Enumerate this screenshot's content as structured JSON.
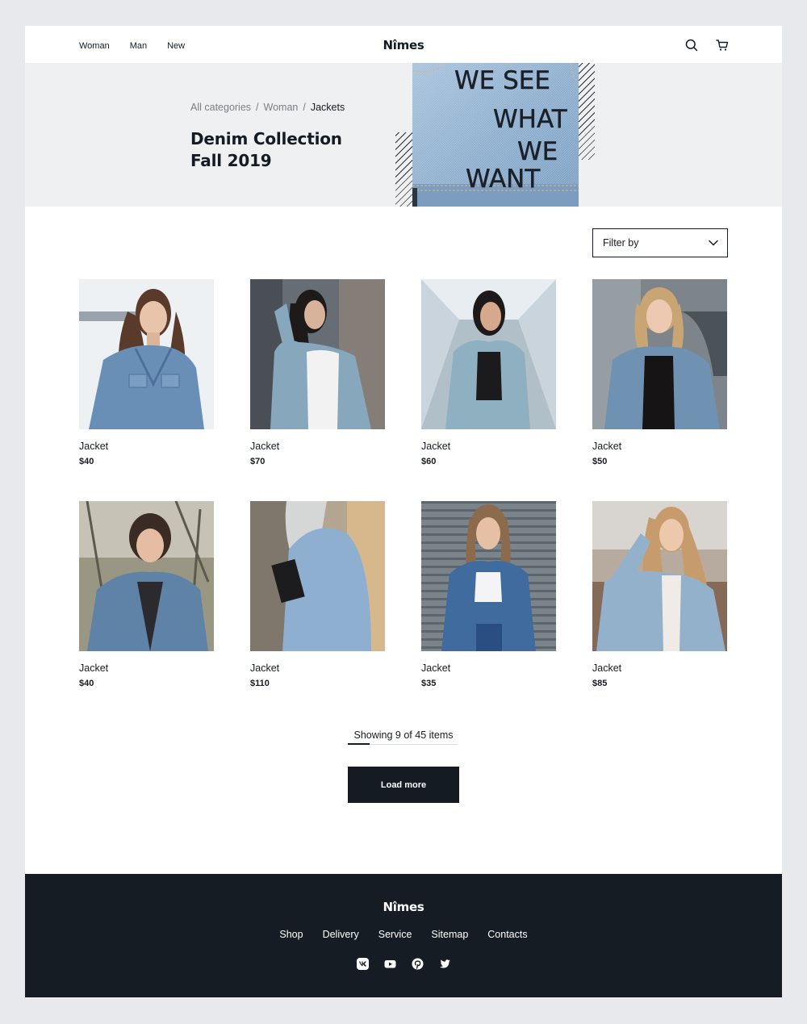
{
  "header": {
    "nav": [
      "Woman",
      "Man",
      "New"
    ],
    "logo": "Nîmes",
    "icons": [
      "search-icon",
      "cart-icon"
    ]
  },
  "hero": {
    "breadcrumb": [
      "All categories",
      "Woman",
      "Jackets"
    ],
    "title_line1": "Denim Collection",
    "title_line2": "Fall 2019",
    "image_text": [
      "WE SEE",
      "WHAT",
      "WE",
      "WANT"
    ]
  },
  "filter": {
    "label": "Filter by"
  },
  "products": [
    {
      "name": "Jacket",
      "price": "$40"
    },
    {
      "name": "Jacket",
      "price": "$70"
    },
    {
      "name": "Jacket",
      "price": "$60"
    },
    {
      "name": "Jacket",
      "price": "$50"
    },
    {
      "name": "Jacket",
      "price": "$40"
    },
    {
      "name": "Jacket",
      "price": "$110"
    },
    {
      "name": "Jacket",
      "price": "$35"
    },
    {
      "name": "Jacket",
      "price": "$85"
    }
  ],
  "pagination": {
    "showing": "Showing 9 of 45 items",
    "shown": 9,
    "total": 45,
    "load_more": "Load more"
  },
  "footer": {
    "logo": "Nîmes",
    "links": [
      "Shop",
      "Delivery",
      "Service",
      "Sitemap",
      "Contacts"
    ],
    "socials": [
      "vk-icon",
      "youtube-icon",
      "pinterest-icon",
      "twitter-icon"
    ]
  },
  "colors": {
    "dark": "#151b22",
    "footer_bg": "#161c23",
    "hero_bg": "#eff0f1",
    "page_bg": "#e8e9ec",
    "denim": "#8fb0cf"
  }
}
